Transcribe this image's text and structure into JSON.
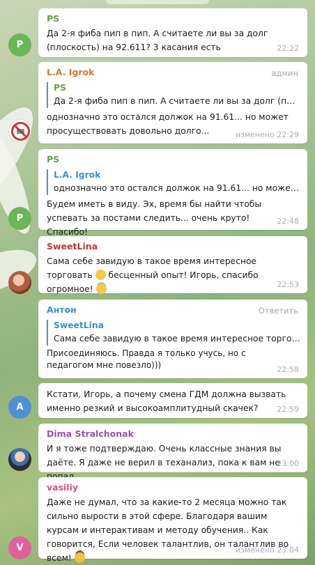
{
  "colors": {
    "name_green": "#5aa33f",
    "name_orange": "#d57a2a",
    "name_red": "#c0392b",
    "name_blue": "#3a8fd0",
    "name_purple": "#9b4fb5",
    "name_pink": "#d04f86"
  },
  "messages": [
    {
      "sender": "PS",
      "text": "Да 2-я фиба пип в пип. А считаете ли вы за долг (плоскость) на 92.611? 3 касания есть",
      "time": "22:22",
      "avatar_letter": "P"
    },
    {
      "sender": "L.A. Igrok",
      "tag": "админ",
      "quote": {
        "name": "PS",
        "text": "Да 2-я фиба пип в пип. А считаете ли вы за долг (плоск..."
      },
      "text": "однозначно это остался должок на 91.61... но может просуществовать довольно долго...",
      "time": "изменено 22:29",
      "avatar_icon": "no-money-sign-icon"
    },
    {
      "sender": "PS",
      "quote": {
        "name": "L.A. Igrok",
        "text": "однозначно это остался должок на 91.61... но может п..."
      },
      "text": "Будем иметь в виду. Эх, время бы найти чтобы успевать за постами следить... очень круто! Спасибо!",
      "time": "22:48",
      "avatar_letter": "P"
    },
    {
      "sender": "SweetLina",
      "text_a": "Сама себе завидую в такое время интересное торговать",
      "text_b": " бесценный опыт! Игорь, спасибо огромное! ",
      "time": "22:53",
      "avatar_icon": "user-photo-icon"
    },
    {
      "sender": "Антон",
      "tag": "Ответить",
      "quote": {
        "name": "SweetLina",
        "text": "Сама себе завидую в такое время интересное торгова..."
      },
      "text": "Присоединяюсь. Правда я только учусь, но с педагогом мне повезло)))",
      "time": "22:58"
    },
    {
      "text": "Кстати, Игорь, а почему смена ГДМ должна вызвать именно резкий и высокоамплитудный скачек?",
      "time": "22:59",
      "avatar_letter": "A"
    },
    {
      "sender": "Dima Stralchonak",
      "text": "И я тоже подтверждаю. Очень классные знания вы даёте. Я даже не верил в теханализ, пока к вам не попал",
      "time": "23:00",
      "avatar_icon": "user-photo-icon"
    },
    {
      "sender": "vasiliy",
      "text": "Даже не думал, что за какие-то 2 месяца можно так сильно вырости в этой сфере. Благодаря вашим курсам и интерактивам и методу обучения.. Как говорится, Если человек талантлив, он талантлив во всем! ",
      "time": "изменено 23:04",
      "avatar_letter": "V"
    }
  ]
}
